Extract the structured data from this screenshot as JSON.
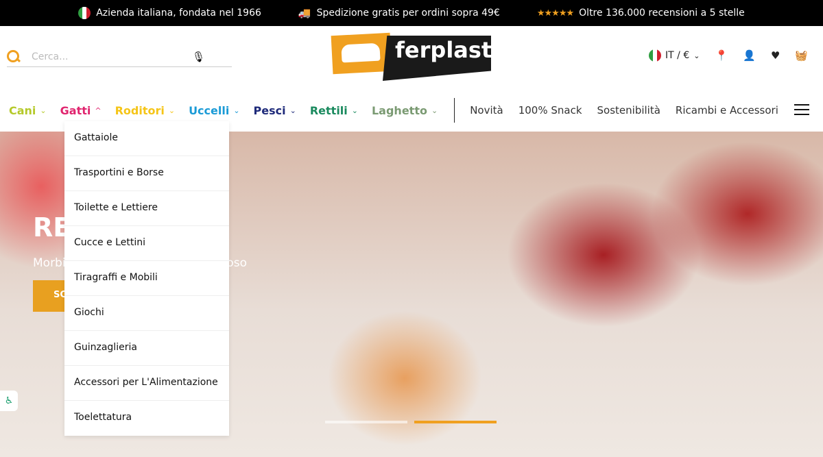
{
  "topbar": {
    "items": [
      {
        "icon": "italy-flag-icon",
        "text": "Azienda italiana, fondata nel 1966"
      },
      {
        "icon": "truck-icon",
        "text": "Spedizione gratis per ordini sopra 49€"
      },
      {
        "icon": "five-stars-icon",
        "stars": "★★★★★",
        "text": "Oltre 136.000 recensioni a 5 stelle"
      }
    ]
  },
  "search": {
    "placeholder": "Cerca..."
  },
  "logo": {
    "text": "ferplast"
  },
  "locale": {
    "label": "IT / €"
  },
  "nav": {
    "categories": [
      {
        "label": "Cani",
        "color": "#b5c92a",
        "chev": "⌄"
      },
      {
        "label": "Gatti",
        "color": "#e0246e",
        "chev": "^"
      },
      {
        "label": "Roditori",
        "color": "#f5c518",
        "chev": "⌄"
      },
      {
        "label": "Uccelli",
        "color": "#1a9ad6",
        "chev": "⌄"
      },
      {
        "label": "Pesci",
        "color": "#1e2a7a",
        "chev": "⌄"
      },
      {
        "label": "Rettili",
        "color": "#1a8a5e",
        "chev": "⌄"
      },
      {
        "label": "Laghetto",
        "color": "#7a9a72",
        "chev": "⌄"
      }
    ],
    "links": [
      "Novità",
      "100% Snack",
      "Sostenibilità",
      "Ricambi e Accessori"
    ]
  },
  "dropdown": {
    "items": [
      "Gattaiole",
      "Trasportini e Borse",
      "Toilette e Lettiere",
      "Cucce e Lettini",
      "Tiragraffi e Mobili",
      "Giochi",
      "Guinzaglieria",
      "Accessori per L'Alimentazione",
      "Toelettatura"
    ]
  },
  "hero": {
    "title_visible": "RE",
    "subtitle_left": "Morbi",
    "subtitle_right": "oso",
    "button_visible": "SC",
    "slide_active": 2,
    "slide_count": 2
  }
}
